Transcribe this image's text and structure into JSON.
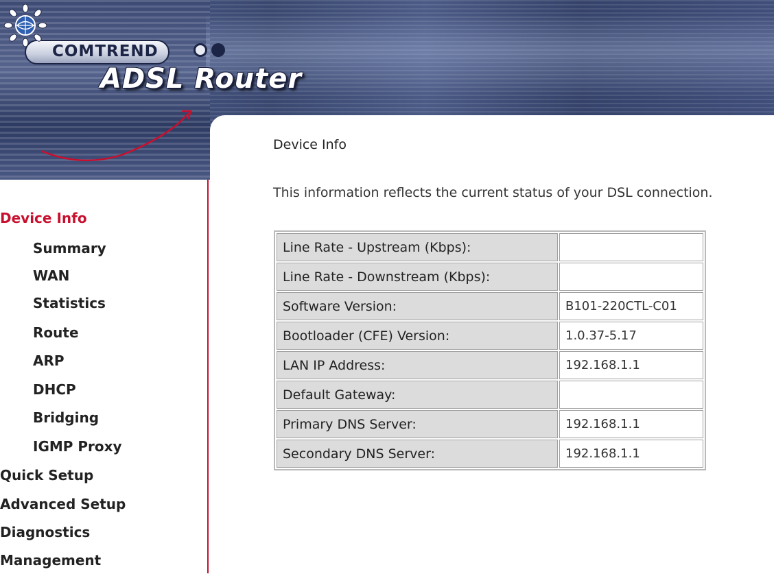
{
  "header": {
    "brand": "COMTREND",
    "product_title": "ADSL Router",
    "colors": {
      "banner": "#3d4a74",
      "accent": "#c8102e"
    }
  },
  "sidebar": {
    "items": [
      {
        "label": "Device Info",
        "level": "top",
        "active": true
      },
      {
        "label": "Summary",
        "level": "sub"
      },
      {
        "label": "WAN",
        "level": "sub"
      },
      {
        "label": "Statistics",
        "level": "sub"
      },
      {
        "label": "Route",
        "level": "sub"
      },
      {
        "label": "ARP",
        "level": "sub"
      },
      {
        "label": "DHCP",
        "level": "sub"
      },
      {
        "label": "Bridging",
        "level": "sub"
      },
      {
        "label": "IGMP Proxy",
        "level": "sub"
      },
      {
        "label": "Quick Setup",
        "level": "top"
      },
      {
        "label": "Advanced Setup",
        "level": "top"
      },
      {
        "label": "Diagnostics",
        "level": "top"
      },
      {
        "label": "Management",
        "level": "top"
      }
    ]
  },
  "main": {
    "title": "Device Info",
    "description": "This information reflects the current status of your DSL connection.",
    "rows": [
      {
        "label": "Line Rate - Upstream (Kbps):",
        "value": ""
      },
      {
        "label": "Line Rate - Downstream (Kbps):",
        "value": ""
      },
      {
        "label": "Software Version:",
        "value": "B101-220CTL-C01"
      },
      {
        "label": "Bootloader (CFE) Version:",
        "value": "1.0.37-5.17"
      },
      {
        "label": "LAN IP Address:",
        "value": "192.168.1.1"
      },
      {
        "label": "Default Gateway:",
        "value": ""
      },
      {
        "label": "Primary DNS Server:",
        "value": "192.168.1.1"
      },
      {
        "label": "Secondary DNS Server:",
        "value": "192.168.1.1"
      }
    ]
  }
}
